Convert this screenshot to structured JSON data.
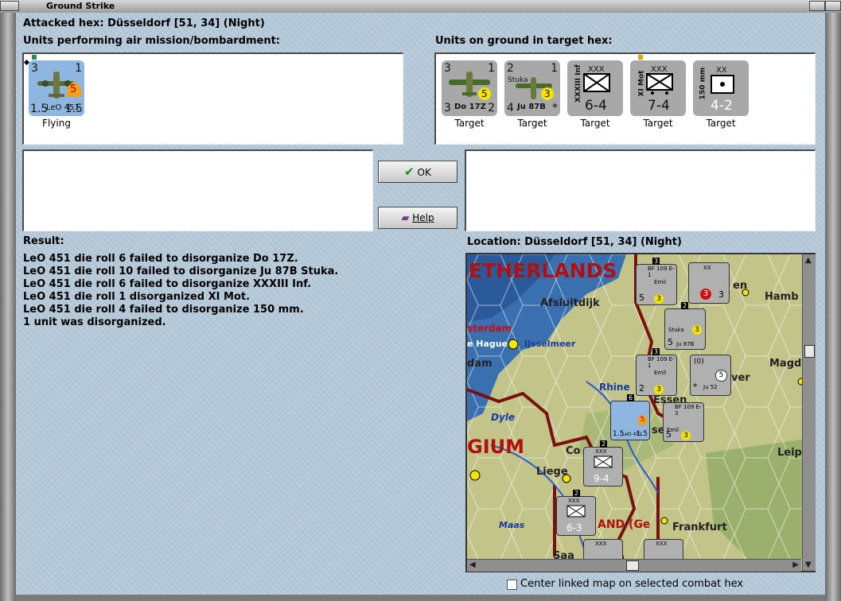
{
  "window": {
    "title": "Ground Strike"
  },
  "header": {
    "attacked_hex": "Attacked hex: Düsseldorf  [51, 34] (Night)"
  },
  "air_panel": {
    "label": "Units performing air mission/bombardment:",
    "units": [
      {
        "tl": "3",
        "tr": "1",
        "bl": "1.5",
        "name": "LeO 451",
        "br": "1.5",
        "badge": "5",
        "status": "Flying"
      }
    ]
  },
  "ground_panel": {
    "label": "Units on ground in target hex:",
    "units": [
      {
        "tl": "3",
        "tr": "1",
        "bl": "3",
        "name": "Do 17Z",
        "br": "2",
        "badge": "5",
        "status": "Target"
      },
      {
        "tl": "2",
        "tr": "1",
        "bl": "4",
        "name": "Ju 87B",
        "br": "*",
        "top_name": "Stuka",
        "badge": "3",
        "status": "Target"
      },
      {
        "size": "XXX",
        "side_name": "XXXIII Inf",
        "value": "6-4",
        "status": "Target"
      },
      {
        "size": "XXX",
        "side_name": "XI Mot",
        "value": "7-4",
        "status": "Target"
      },
      {
        "size": "XX",
        "side_name": "150 mm",
        "value": "4-2",
        "status": "Target"
      }
    ]
  },
  "buttons": {
    "ok": "OK",
    "help": "Help"
  },
  "result": {
    "label": "Result:",
    "lines": [
      "LeO 451 die roll 6 failed to disorganize Do 17Z.",
      "LeO 451 die roll 10 failed to disorganize Ju 87B Stuka.",
      "LeO 451 die roll 6 failed to disorganize XXXIII Inf.",
      "LeO 451 die roll 1 disorganized XI Mot.",
      "LeO 451 die roll 4 failed to disorganize 150 mm.",
      "1 unit was disorganized."
    ]
  },
  "location": {
    "label": "Location:  Düsseldorf  [51, 34] (Night)"
  },
  "map": {
    "labels": {
      "netherlands": "ETHERLANDS",
      "afsluitdijk": "Afsluitdijk",
      "amsterdam": "sterdam",
      "hague": "e Hague",
      "ijsselmeer": "IJsselmeer",
      "dam": "dam",
      "rhine": "Rhine",
      "dyle": "Dyle",
      "belgium": "GIUM",
      "liege": "Liege",
      "maas": "Maas",
      "land": "AND (Ge",
      "frankfurt": "Frankfurt",
      "essen": "Essen",
      "hamb": "Hamb",
      "magd": "Magd",
      "leip": "Leip",
      "hannover": "ver",
      "koeln": "Co",
      "saar": "Saa",
      "sel": "sel",
      "en": "en"
    },
    "counters": [
      {
        "id": "bf109-a",
        "type": "BF 109 E-1",
        "sub": "Emil",
        "bl": "5",
        "br": "3",
        "stack": "3"
      },
      {
        "id": "aa-stack",
        "type": "XX",
        "bl": "3",
        "br": "3",
        "badge": "3"
      },
      {
        "id": "stuka",
        "type": "Stuka",
        "sub": "Ju 87B",
        "bl": "5",
        "br": "3",
        "stack": "2"
      },
      {
        "id": "bf109-b",
        "type": "BF 109 E-1",
        "sub": "Emil",
        "bl": "2",
        "br": "3",
        "stack": "3"
      },
      {
        "id": "ju52",
        "type": "(0)",
        "sub": "Ju 52",
        "bl": "*",
        "br": "5"
      },
      {
        "id": "leo451",
        "type": "LeO 451",
        "bl": "1.5",
        "br": "1.5",
        "badge": "5",
        "stack": "6"
      },
      {
        "id": "bf109-c",
        "type": "BF 109 E-3",
        "sub": "Emil",
        "bl": "5",
        "br": "3"
      },
      {
        "id": "xxx-94",
        "type": "XXX",
        "value": "9-4",
        "stack": "2"
      },
      {
        "id": "xxx-63",
        "type": "XXX",
        "value": "6-3",
        "stack": "2"
      },
      {
        "id": "xxx-a",
        "type": "XXX"
      },
      {
        "id": "xxx-b",
        "type": "XXX"
      }
    ]
  },
  "footer": {
    "center_checkbox_label": "Center linked map on selected combat hex"
  },
  "colors": {
    "background": "#b4c8d8",
    "panel": "#ffffff",
    "map_border": "#7a1010",
    "badge_yellow": "#f5e400",
    "badge_orange": "#f0a020"
  }
}
